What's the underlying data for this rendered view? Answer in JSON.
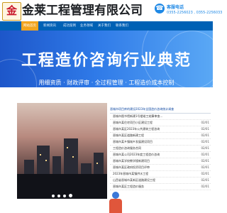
{
  "header": {
    "logo_glyph": "金",
    "company_name": "金莱工程管理有限公司",
    "hotline_label": "客服电话",
    "hotline_numbers": "0355-2256023 , 0355-2256033"
  },
  "nav": {
    "items": [
      {
        "label": "网站首页",
        "active": true
      },
      {
        "label": "新闻资讯",
        "active": false
      },
      {
        "label": "成功案例",
        "active": false
      },
      {
        "label": "业务领域",
        "active": false
      },
      {
        "label": "关于我们",
        "active": false
      },
      {
        "label": "联系我们",
        "active": false
      }
    ]
  },
  "banner": {
    "title": "工程造价咨询行业典范",
    "subtitle": "用细资质 · 财政评审 · 全过程管理 · 工程造价成本控制"
  },
  "carousel": {
    "dot_count": 4,
    "active_index": 3
  },
  "news": {
    "header": "晋城市项目库的建设2023年全国造价咨询统计调查",
    "rows": [
      {
        "title": "晋城市图书馆新建1号楼竣工结算审查...",
        "date": ""
      },
      {
        "title": "晋城市某住宅项目小区建设工程",
        "date": "02/01"
      },
      {
        "title": "晋城市某区2023年公共建筑工程咨询",
        "date": "02/01"
      },
      {
        "title": "晋城市某区道路新建工程",
        "date": "02/01"
      },
      {
        "title": "晋城市某乡镇城乡发展建设项目",
        "date": "02/01"
      },
      {
        "title": "工程造价咨询服务合同",
        "date": "02/01"
      },
      {
        "title": "晋城市某公司2023年度工程造价咨询",
        "date": "02/01"
      },
      {
        "title": "晋城市某学校教学楼新建项目",
        "date": "02/01"
      },
      {
        "title": "晋城市某区政府投资项目评审",
        "date": "02/01"
      },
      {
        "title": "2023年晋城市某镇供水工程",
        "date": "02/01"
      },
      {
        "title": "山西省晋城市某新区道路建设工程",
        "date": "02/01"
      },
      {
        "title": "晋城市某区工程造价服务",
        "date": "02/01"
      }
    ]
  }
}
